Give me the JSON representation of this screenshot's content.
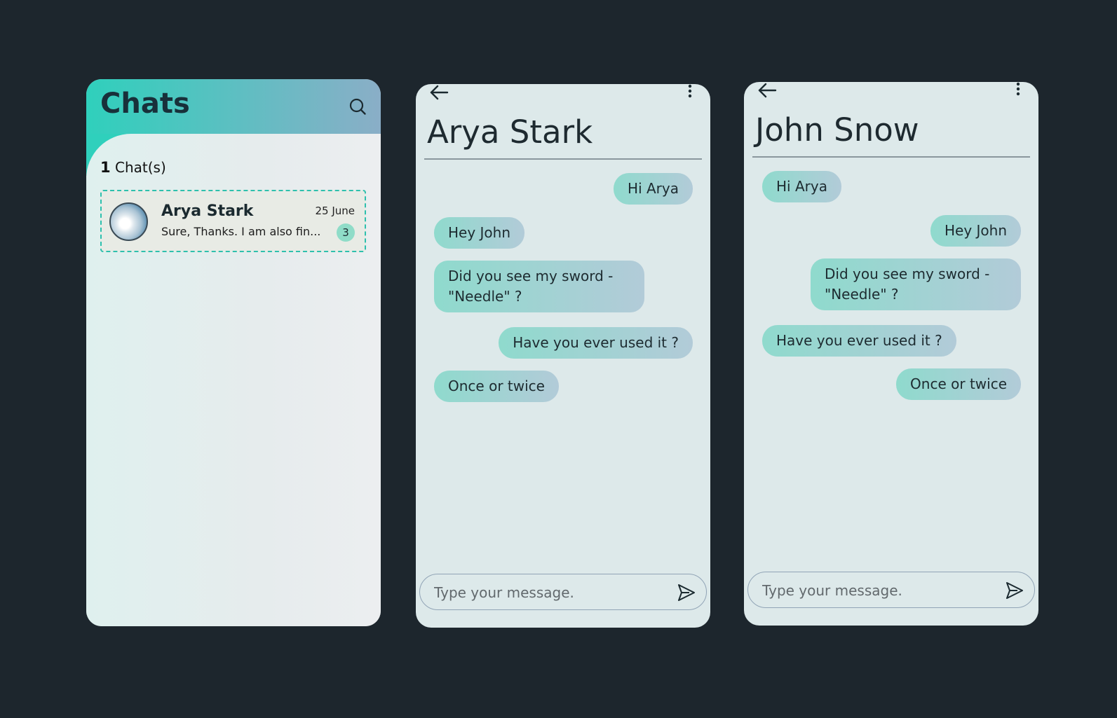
{
  "chat_list": {
    "title": "Chats",
    "count_number": "1",
    "count_label": "Chat(s)",
    "items": [
      {
        "name": "Arya Stark",
        "date": "25 June",
        "preview": "Sure, Thanks. I am also fin...",
        "unread": "3"
      }
    ]
  },
  "conversations": [
    {
      "title": "Arya Stark",
      "messages": [
        {
          "text": "Hi Arya",
          "side": "right"
        },
        {
          "text": "Hey John",
          "side": "left"
        },
        {
          "text": "Did you see my sword - \"Needle\" ?",
          "side": "left"
        },
        {
          "text": "Have you ever used it ?",
          "side": "right"
        },
        {
          "text": "Once or twice",
          "side": "left"
        }
      ],
      "input_placeholder": "Type your message."
    },
    {
      "title": "John Snow",
      "messages": [
        {
          "text": "Hi Arya",
          "side": "left"
        },
        {
          "text": "Hey John",
          "side": "right"
        },
        {
          "text": "Did you see my sword - \"Needle\" ?",
          "side": "right"
        },
        {
          "text": "Have you ever used it ?",
          "side": "left"
        },
        {
          "text": "Once or twice",
          "side": "right"
        }
      ],
      "input_placeholder": "Type your message."
    }
  ],
  "colors": {
    "background": "#1d262d",
    "accent": "#2fd0bc",
    "bubble_start": "#8fdacd",
    "bubble_end": "#b2cbd8"
  }
}
